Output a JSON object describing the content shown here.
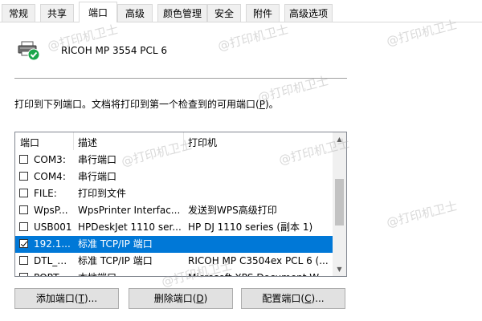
{
  "tabs": [
    {
      "label": "常规"
    },
    {
      "label": "共享"
    },
    {
      "label": "端口"
    },
    {
      "label": "高级"
    },
    {
      "label": "颜色管理"
    },
    {
      "label": "安全"
    },
    {
      "label": "附件"
    },
    {
      "label": "高级选项"
    }
  ],
  "active_tab": "端口",
  "printer": {
    "name": "RICOH MP 3554 PCL 6"
  },
  "instruction": {
    "text": "打印到下列端口。文档将打印到第一个检查到的可用端口(",
    "mnemonic": "P",
    "suffix": ")。"
  },
  "columns": {
    "port": "端口",
    "desc": "描述",
    "printer": "打印机"
  },
  "rows": [
    {
      "checked": false,
      "port": "COM3:",
      "desc": "串行端口",
      "printer": ""
    },
    {
      "checked": false,
      "port": "COM4:",
      "desc": "串行端口",
      "printer": ""
    },
    {
      "checked": false,
      "port": "FILE:",
      "desc": "打印到文件",
      "printer": ""
    },
    {
      "checked": false,
      "port": "WpsP...",
      "desc": "WpsPrinter Interfac...",
      "printer": "发送到WPS高级打印"
    },
    {
      "checked": false,
      "port": "USB001",
      "desc": "HPDeskJet 1110 ser...",
      "printer": "HP DJ 1110 series (副本 1)"
    },
    {
      "checked": true,
      "port": "192.1...",
      "desc": "标准 TCP/IP 端口",
      "printer": "",
      "selected": true
    },
    {
      "checked": false,
      "port": "DTL_1...",
      "desc": "标准 TCP/IP 端口",
      "printer": "RICOH MP C3504ex PCL 6 (..."
    },
    {
      "checked": false,
      "port": "PORT...",
      "desc": "本地端口",
      "printer": "Microsoft XPS Document W..."
    }
  ],
  "buttons": {
    "add": {
      "text": "添加端口(",
      "mnemonic": "T",
      "suffix": ")..."
    },
    "delete": {
      "text": "删除端口(",
      "mnemonic": "D",
      "suffix": ")"
    },
    "config": {
      "text": "配置端口(",
      "mnemonic": "C",
      "suffix": ")..."
    }
  },
  "watermark": "@打印机卫士",
  "colors": {
    "selection": "#0078d7",
    "check_badge": "#1aa64a"
  },
  "icons": {
    "printer": "printer-default-icon",
    "scroll_up": "scroll-up-icon",
    "scroll_down": "scroll-down-icon"
  }
}
